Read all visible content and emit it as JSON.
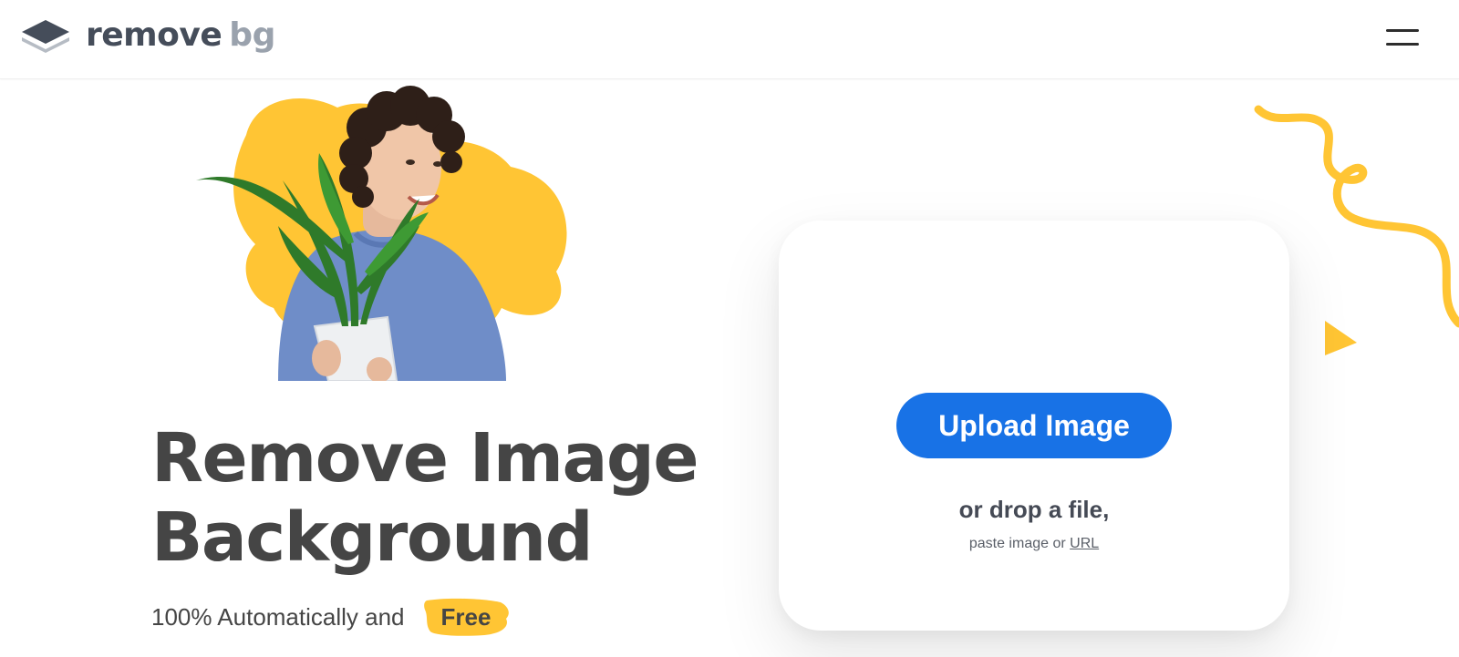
{
  "header": {
    "logo_text_primary": "remove",
    "logo_text_secondary": "bg",
    "menu_icon": "hamburger-menu-icon"
  },
  "hero": {
    "illustration_icon": "man-holding-plant-illustration",
    "headline_line1": "Remove Image",
    "headline_line2": "Background",
    "subline_text": "100% Automatically and",
    "subline_badge": "Free"
  },
  "upload": {
    "button_label": "Upload Image",
    "drop_text": "or drop a file,",
    "paste_prefix": "paste image or",
    "url_link": "URL"
  },
  "colors": {
    "accent_blue": "#1872e6",
    "accent_yellow": "#ffc534",
    "text_dark": "#454545",
    "logo_gray": "#9aa2ad"
  }
}
